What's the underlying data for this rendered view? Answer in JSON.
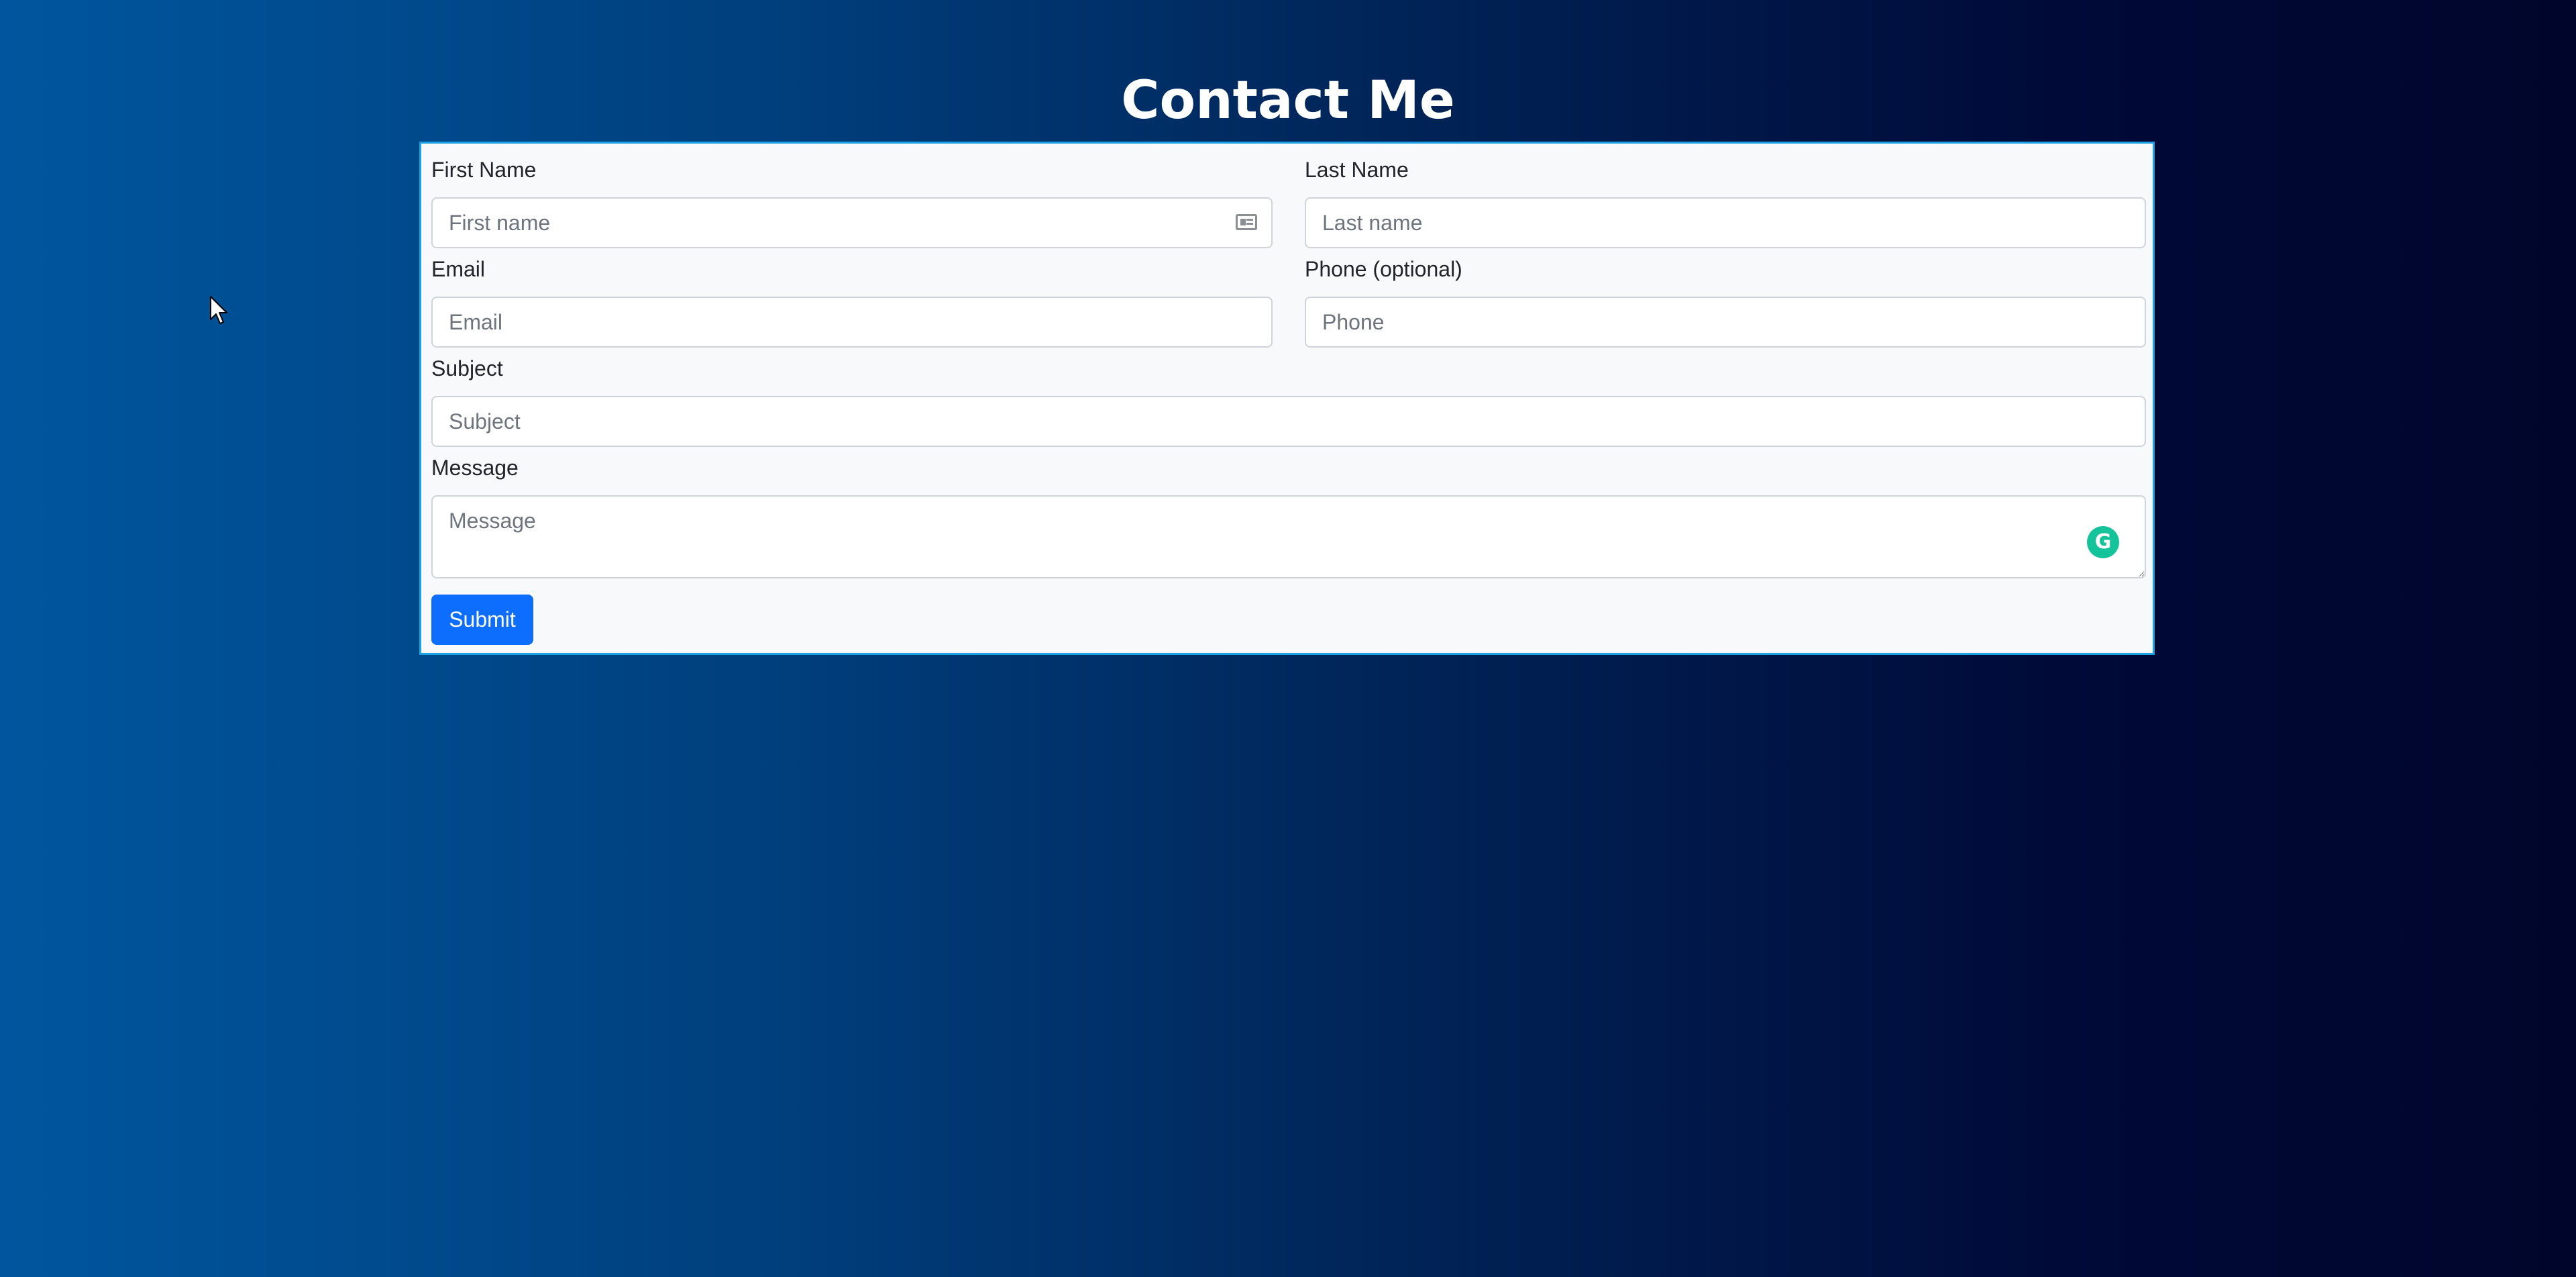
{
  "page": {
    "title": "Contact Me",
    "background_from": "#00569e",
    "background_to": "#00052b"
  },
  "form": {
    "first_name": {
      "label": "First Name",
      "placeholder": "First name",
      "value": ""
    },
    "last_name": {
      "label": "Last Name",
      "placeholder": "Last name",
      "value": ""
    },
    "email": {
      "label": "Email",
      "placeholder": "Email",
      "value": ""
    },
    "phone": {
      "label": "Phone (optional)",
      "placeholder": "Phone",
      "value": ""
    },
    "subject": {
      "label": "Subject",
      "placeholder": "Subject",
      "value": ""
    },
    "message": {
      "label": "Message",
      "placeholder": "Message",
      "value": ""
    },
    "submit_label": "Submit",
    "accent_color": "#0d6efd",
    "border_color": "#1da1e2"
  },
  "icons": {
    "autofill": "contact-card-icon",
    "grammar": "grammarly-icon",
    "grammar_color": "#15c39a"
  }
}
